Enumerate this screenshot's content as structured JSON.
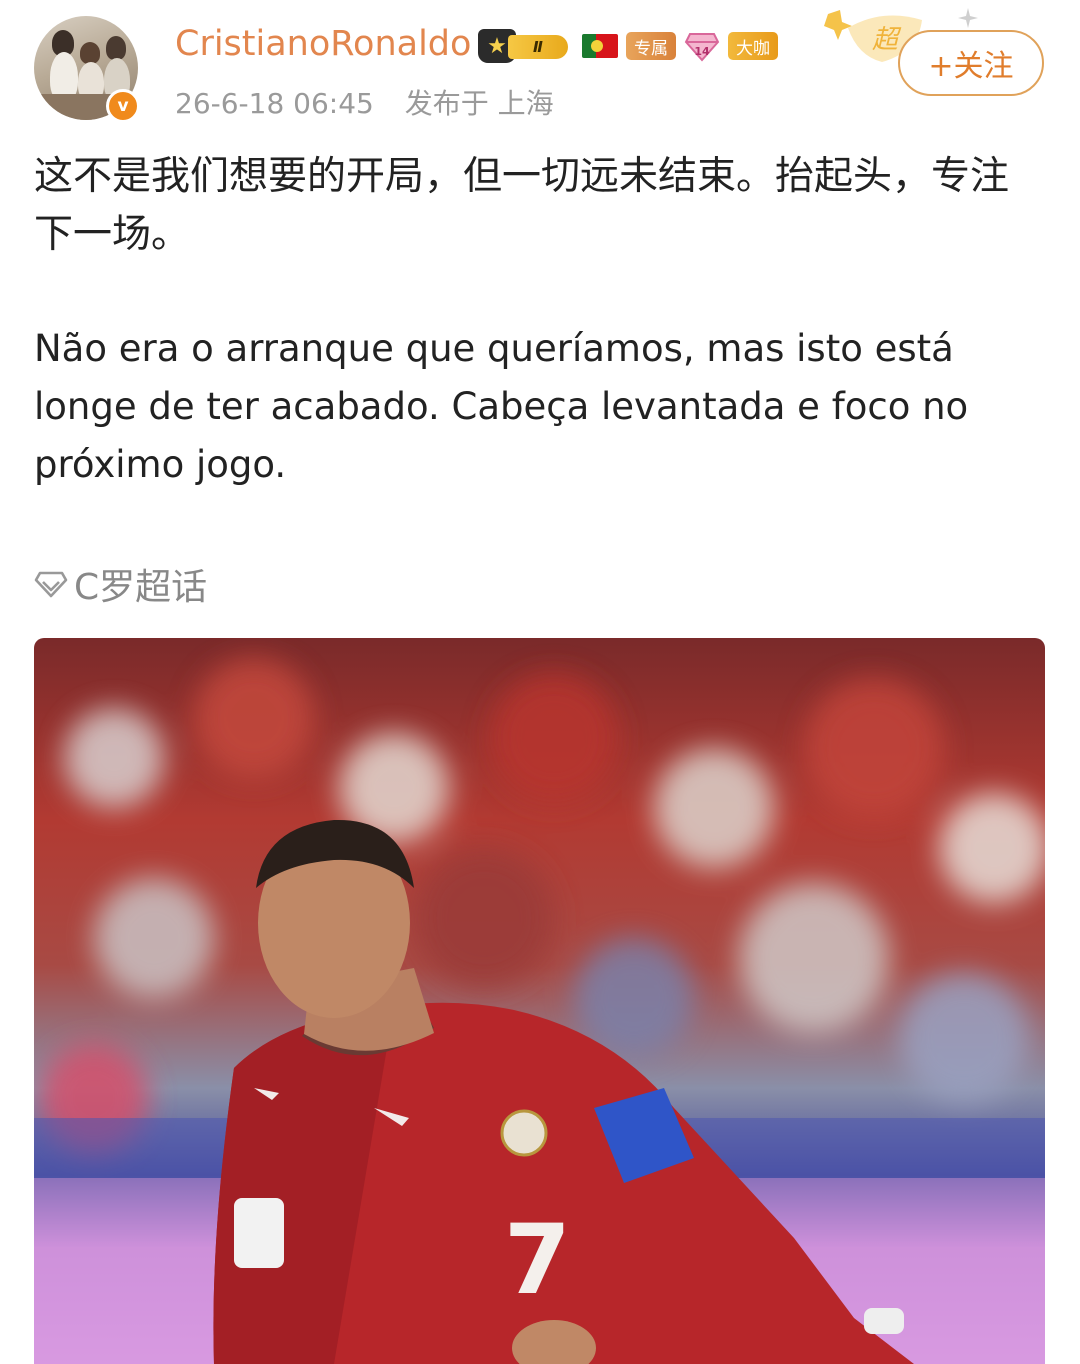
{
  "post": {
    "author": {
      "username": "CristianoRonaldo",
      "level_badge": "Ⅱ",
      "exclusive_badge": "专属",
      "fan_badge_number": "14",
      "dk_badge": "大咖",
      "super_label": "超",
      "verified_mark": "v"
    },
    "timestamp": "26-6-18 06:45",
    "location": "发布于 上海",
    "follow_label": "+关注",
    "text_cn": "这不是我们想要的开局，但一切远未结束。抬起头，专注下一场。",
    "text_pt": "Não era o arranque que queríamos, mas isto está longe de ter acabado. Cabeça levantada e foco no próximo jogo.",
    "topic_label": "C罗超话",
    "photo": {
      "jersey_number": "7"
    }
  },
  "colors": {
    "username": "#e2864e",
    "follow_border": "#e0a25a",
    "follow_text": "#e07d2c",
    "meta_text": "#9a9a9a",
    "body_text": "#222222",
    "topic_text": "#888888"
  },
  "icons": [
    "verified-icon",
    "crown-icon",
    "portugal-flag-icon",
    "gem-icon",
    "topic-diamond-icon"
  ]
}
